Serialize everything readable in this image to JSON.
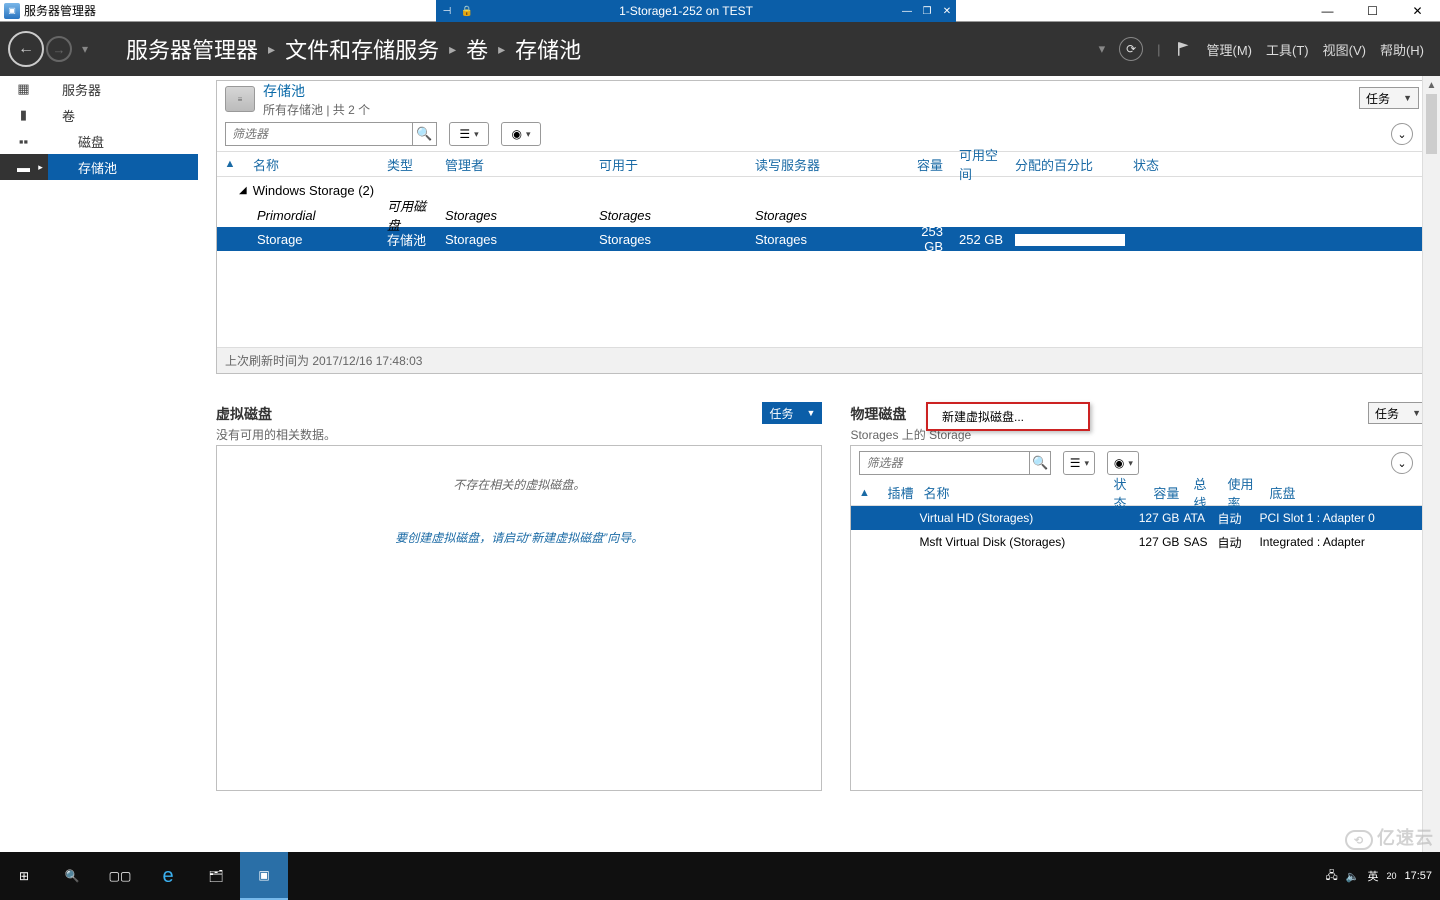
{
  "outer_title": "服务器管理器",
  "inner_title": "1-Storage1-252 on TEST",
  "breadcrumb": [
    "服务器管理器",
    "文件和存储服务",
    "卷",
    "存储池"
  ],
  "menu": {
    "manage": "管理(M)",
    "tools": "工具(T)",
    "view": "视图(V)",
    "help": "帮助(H)"
  },
  "sidebar": {
    "items": [
      "服务器",
      "卷",
      "磁盘",
      "存储池"
    ],
    "selected": 3
  },
  "pools": {
    "title": "存储池",
    "subtitle": "所有存储池 | 共 2 个",
    "tasks": "任务",
    "filter_placeholder": "筛选器",
    "columns": [
      "名称",
      "类型",
      "管理者",
      "可用于",
      "读写服务器",
      "容量",
      "可用空间",
      "分配的百分比",
      "状态"
    ],
    "group": "Windows Storage (2)",
    "rows": [
      {
        "name": "Primordial",
        "type": "可用磁盘",
        "mgr": "Storages",
        "avail": "Storages",
        "rw": "Storages",
        "cap": "",
        "free": "",
        "sel": false,
        "italic": true
      },
      {
        "name": "Storage",
        "type": "存储池",
        "mgr": "Storages",
        "avail": "Storages",
        "rw": "Storages",
        "cap": "253 GB",
        "free": "252 GB",
        "sel": true
      }
    ],
    "footnote": "上次刷新时间为 2017/12/16 17:48:03"
  },
  "vdisks": {
    "title": "虚拟磁盘",
    "subtitle": "没有可用的相关数据。",
    "tasks": "任务",
    "empty1": "不存在相关的虚拟磁盘。",
    "empty2": "要创建虚拟磁盘，请启动“新建虚拟磁盘”向导。",
    "menu_item": "新建虚拟磁盘..."
  },
  "pdisks": {
    "title": "物理磁盘",
    "subtitle": "Storages 上的 Storage",
    "tasks": "任务",
    "filter_placeholder": "筛选器",
    "columns": [
      "插槽",
      "名称",
      "状态",
      "容量",
      "总线",
      "使用率",
      "底盘"
    ],
    "rows": [
      {
        "slot": "",
        "name": "Virtual HD (Storages)",
        "stat": "",
        "cap": "127 GB",
        "bus": "ATA",
        "use": "自动",
        "chas": "PCI Slot 1 : Adapter 0",
        "sel": true
      },
      {
        "slot": "",
        "name": "Msft Virtual Disk (Storages)",
        "stat": "",
        "cap": "127 GB",
        "bus": "SAS",
        "use": "自动",
        "chas": "Integrated : Adapter",
        "sel": false
      }
    ]
  },
  "taskbar": {
    "ime": "英",
    "ime_num": "20",
    "time": "17:57"
  },
  "watermark": "亿速云"
}
